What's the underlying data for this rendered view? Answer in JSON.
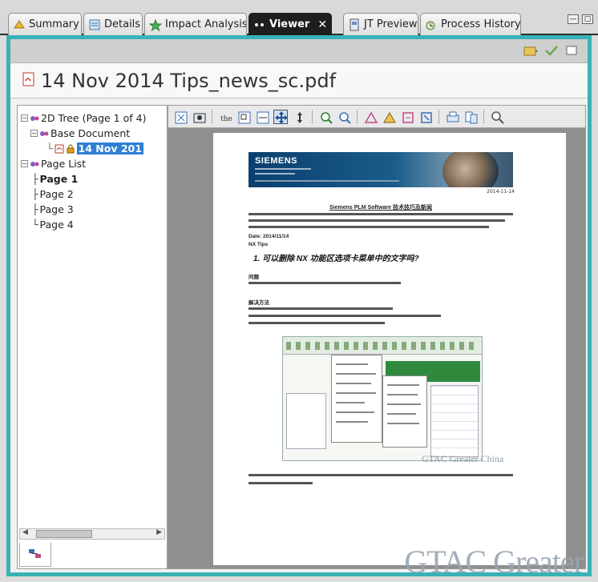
{
  "tabs": [
    {
      "label": "Summary",
      "icon": "summary-icon",
      "active": false
    },
    {
      "label": "Details",
      "icon": "details-icon",
      "active": false
    },
    {
      "label": "Impact Analysis",
      "icon": "impact-analysis-icon",
      "active": false
    },
    {
      "label": "Viewer",
      "icon": "viewer-icon",
      "active": true
    },
    {
      "label": "JT Preview",
      "icon": "jt-preview-icon",
      "active": false
    },
    {
      "label": "Process History",
      "icon": "process-history-icon",
      "active": false
    }
  ],
  "viewer_title": "14 Nov 2014 Tips_news_sc.pdf",
  "tree": {
    "root_2d": "2D Tree (Page 1 of 4)",
    "base_document": "Base Document",
    "dataset": "14 Nov 201",
    "page_list": "Page List",
    "pages": [
      "Page 1",
      "Page 2",
      "Page 3",
      "Page 4"
    ]
  },
  "pdf": {
    "brand": "SIEMENS",
    "date": "2014-11-14",
    "heading": "Siemens PLM Software 技术技巧及新闻",
    "date_line": "Date: 2014/11/14",
    "nx_tips": "NX Tips",
    "numbered_heading": "1. 可以删除 NX 功能区选项卡菜单中的文字吗?",
    "problem_label": "问题",
    "solution_label": "解决方法",
    "screenshot_watermark": "GTAC Greater China"
  },
  "watermark": "GTAC Greater",
  "colors": {
    "frame_border": "#39b2b5",
    "selection": "#2f7fd6",
    "active_tab": "#1e1e1e"
  }
}
